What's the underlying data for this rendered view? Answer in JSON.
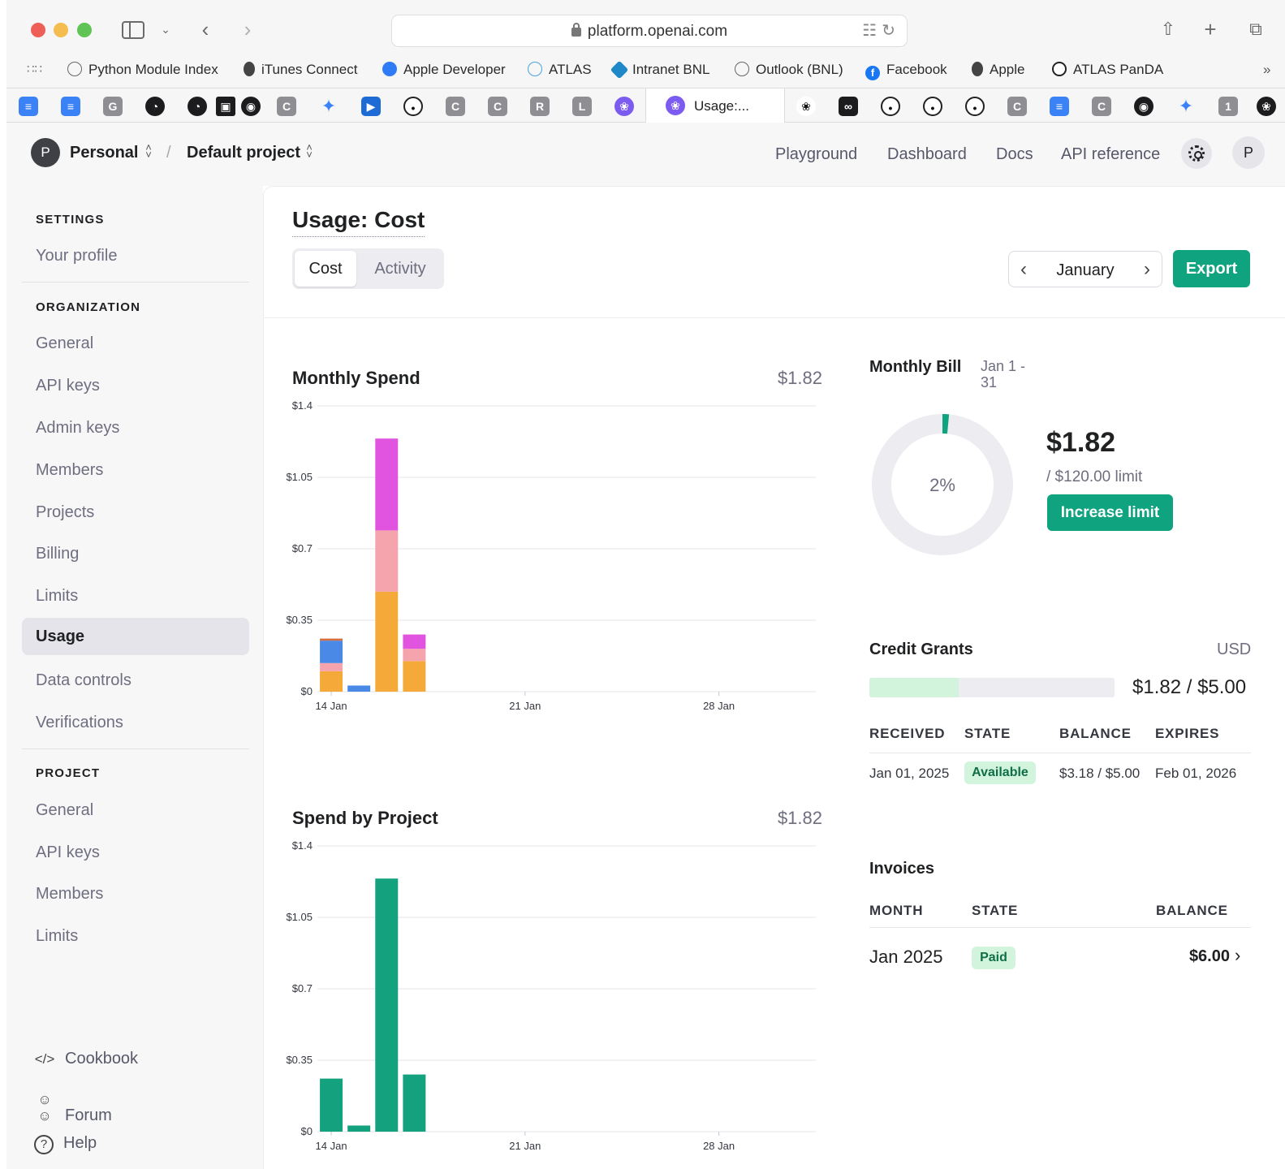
{
  "browser": {
    "url": "platform.openai.com",
    "bookmarks": [
      {
        "label": "Python Module Index",
        "icon": "globe-icon"
      },
      {
        "label": "iTunes Connect",
        "icon": "apple-icon"
      },
      {
        "label": "Apple Developer",
        "icon": "apple-developer-icon"
      },
      {
        "label": "ATLAS",
        "icon": "atlas-icon"
      },
      {
        "label": "Intranet BNL",
        "icon": "bnl-icon"
      },
      {
        "label": "Outlook (BNL)",
        "icon": "globe-icon"
      },
      {
        "label": "Facebook",
        "icon": "facebook-icon"
      },
      {
        "label": "Apple",
        "icon": "apple-icon"
      },
      {
        "label": "ATLAS PanDA",
        "icon": "panda-icon"
      }
    ],
    "pinned_tab_letters": [
      "G",
      "C",
      "C",
      "C",
      "R",
      "L",
      "C",
      "C",
      "1"
    ],
    "active_tab": {
      "label": "Usage:..."
    }
  },
  "header": {
    "workspace_initial": "P",
    "workspace": "Personal",
    "separator": "/",
    "project": "Default project",
    "nav": [
      "Playground",
      "Dashboard",
      "Docs",
      "API reference"
    ],
    "user_initial": "P"
  },
  "sidebar": {
    "settings_title": "SETTINGS",
    "settings_items": [
      "Your profile"
    ],
    "organization_title": "ORGANIZATION",
    "organization_items": [
      "General",
      "API keys",
      "Admin keys",
      "Members",
      "Projects",
      "Billing",
      "Limits",
      "Usage",
      "Data controls",
      "Verifications"
    ],
    "active_item": "Usage",
    "project_title": "PROJECT",
    "project_items": [
      "General",
      "API keys",
      "Members",
      "Limits"
    ],
    "footer": [
      {
        "label": "Cookbook",
        "icon": "code-icon"
      },
      {
        "label": "Forum",
        "icon": "people-icon"
      },
      {
        "label": "Help",
        "icon": "help-icon"
      }
    ]
  },
  "main": {
    "title": "Usage: Cost",
    "tabs": [
      "Cost",
      "Activity"
    ],
    "active_tab": "Cost",
    "month": "January",
    "export_label": "Export"
  },
  "chart_data": [
    {
      "type": "bar",
      "stacked": true,
      "title": "Monthly Spend",
      "total": "$1.82",
      "ylim": [
        0,
        1.4
      ],
      "ytick_labels": [
        "$0",
        "$0.35",
        "$0.7",
        "$1.05",
        "$1.4"
      ],
      "ytick_values": [
        0,
        0.35,
        0.7,
        1.05,
        1.4
      ],
      "xtick_labels": [
        "14 Jan",
        "21 Jan",
        "28 Jan"
      ],
      "x_start_day": 14,
      "x_end_day": 31,
      "grid": true,
      "series_colors": [
        "#f4a938",
        "#f5a3ad",
        "#4a8ae6",
        "#e054e0",
        "#d96c3c"
      ],
      "bars": [
        {
          "day": 14,
          "segments": [
            0.1,
            0.04,
            0.11,
            0,
            0.01
          ]
        },
        {
          "day": 15,
          "segments": [
            0,
            0,
            0.03,
            0,
            0
          ]
        },
        {
          "day": 16,
          "segments": [
            0.49,
            0.3,
            0,
            0.45,
            0
          ]
        },
        {
          "day": 17,
          "segments": [
            0.15,
            0.06,
            0,
            0.07,
            0
          ]
        }
      ]
    },
    {
      "type": "bar",
      "title": "Spend by Project",
      "total": "$1.82",
      "ylim": [
        0,
        1.4
      ],
      "ytick_labels": [
        "$0",
        "$0.35",
        "$0.7",
        "$1.05",
        "$1.4"
      ],
      "ytick_values": [
        0,
        0.35,
        0.7,
        1.05,
        1.4
      ],
      "xtick_labels": [
        "14 Jan",
        "21 Jan",
        "28 Jan"
      ],
      "x_start_day": 14,
      "x_end_day": 31,
      "grid": true,
      "color": "#14a17e",
      "bars": [
        {
          "day": 14,
          "value": 0.26
        },
        {
          "day": 15,
          "value": 0.03
        },
        {
          "day": 16,
          "value": 1.24
        },
        {
          "day": 17,
          "value": 0.28
        }
      ]
    }
  ],
  "bill": {
    "title": "Monthly Bill",
    "range": "Jan 1 - 31",
    "percent_label": "2%",
    "percent": 0.015,
    "amount": "$1.82",
    "limit": "/ $120.00 limit",
    "increase_label": "Increase limit",
    "ring_color": "#10a37f",
    "track_color": "#ececf1"
  },
  "credit_grants": {
    "title": "Credit Grants",
    "currency": "USD",
    "used_fraction": 0.364,
    "value": "$1.82 / $5.00",
    "columns": [
      "RECEIVED",
      "STATE",
      "BALANCE",
      "EXPIRES"
    ],
    "rows": [
      {
        "received": "Jan 01, 2025",
        "state": "Available",
        "balance": "$3.18 / $5.00",
        "expires": "Feb 01, 2026"
      }
    ]
  },
  "invoices": {
    "title": "Invoices",
    "columns": [
      "MONTH",
      "STATE",
      "BALANCE"
    ],
    "rows": [
      {
        "month": "Jan 2025",
        "state": "Paid",
        "balance": "$6.00"
      }
    ]
  }
}
